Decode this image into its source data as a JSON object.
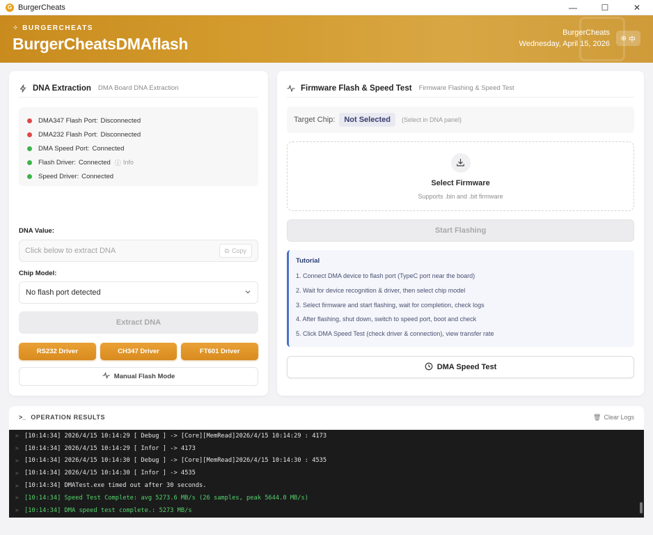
{
  "window": {
    "title": "BurgerCheats",
    "app_icon_letter": "G",
    "controls": {
      "minimize": "—",
      "maximize": "☐",
      "close": "✕"
    }
  },
  "header": {
    "brand_small": "BURGERCHEATS",
    "title": "BurgerCheatsDMAflash",
    "user": "BurgerCheats",
    "date": "Wednesday, April 15, 2026",
    "lang": "中"
  },
  "dna_panel": {
    "title": "DNA Extraction",
    "subtitle": "DMA Board DNA Extraction",
    "status": [
      {
        "label": "DMA347 Flash Port:",
        "value": "Disconnected",
        "state": "red"
      },
      {
        "label": "DMA232 Flash Port:",
        "value": "Disconnected",
        "state": "red"
      },
      {
        "label": "DMA Speed Port:",
        "value": "Connected",
        "state": "green"
      },
      {
        "label": "Flash Driver:",
        "value": "Connected",
        "state": "green",
        "extra": "Info"
      },
      {
        "label": "Speed Driver:",
        "value": "Connected",
        "state": "green"
      }
    ],
    "dna_label": "DNA Value:",
    "dna_placeholder": "Click below to extract DNA",
    "copy_label": "Copy",
    "chip_label": "Chip Model:",
    "chip_value": "No flash port detected",
    "extract_label": "Extract DNA",
    "drivers": [
      "RS232 Driver",
      "CH347 Driver",
      "FT601 Driver"
    ],
    "manual_label": "Manual Flash Mode"
  },
  "flash_panel": {
    "title": "Firmware Flash & Speed Test",
    "subtitle": "Firmware Flashing & Speed Test",
    "target_label": "Target Chip:",
    "target_value": "Not Selected",
    "target_hint": "(Select in DNA panel)",
    "select_title": "Select Firmware",
    "select_sub": "Supports .bin and .bit firmware",
    "start_label": "Start Flashing",
    "tutorial_title": "Tutorial",
    "tutorial_steps": [
      "1. Connect DMA device to flash port (TypeC port near the board)",
      "2. Wait for device recognition & driver, then select chip model",
      "3. Select firmware and start flashing, wait for completion, check logs",
      "4. After flashing, shut down, switch to speed port, boot and check",
      "5. Click DMA Speed Test (check driver & connection), view transfer rate"
    ],
    "speed_label": "DMA Speed Test"
  },
  "results": {
    "title": "OPERATION RESULTS",
    "clear_label": "Clear Logs",
    "logs": [
      {
        "text": "[10:14:34] 2026/4/15 10:14:29 [ Debug ] -> [Core][MemRead]2026/4/15 10:14:29 : 4173",
        "color": "white"
      },
      {
        "text": "[10:14:34] 2026/4/15 10:14:29 [ Infor ] -> 4173",
        "color": "white"
      },
      {
        "text": "[10:14:34] 2026/4/15 10:14:30 [ Debug ] -> [Core][MemRead]2026/4/15 10:14:30 : 4535",
        "color": "white"
      },
      {
        "text": "[10:14:34] 2026/4/15 10:14:30 [ Infor ] -> 4535",
        "color": "white"
      },
      {
        "text": "[10:14:34] DMATest.exe timed out after 30 seconds.",
        "color": "white"
      },
      {
        "text": "[10:14:34] Speed Test Complete: avg 5273.6 MB/s (26 samples, peak 5644.0 MB/s)",
        "color": "green"
      },
      {
        "text": "[10:14:34] DMA speed test complete.: 5273 MB/s",
        "color": "green"
      }
    ]
  },
  "colors": {
    "accent": "#d98b1f",
    "status_red": "#e04848",
    "status_green": "#3cb44b",
    "log_green": "#55d46a",
    "tutorial_accent": "#4a72c9"
  }
}
